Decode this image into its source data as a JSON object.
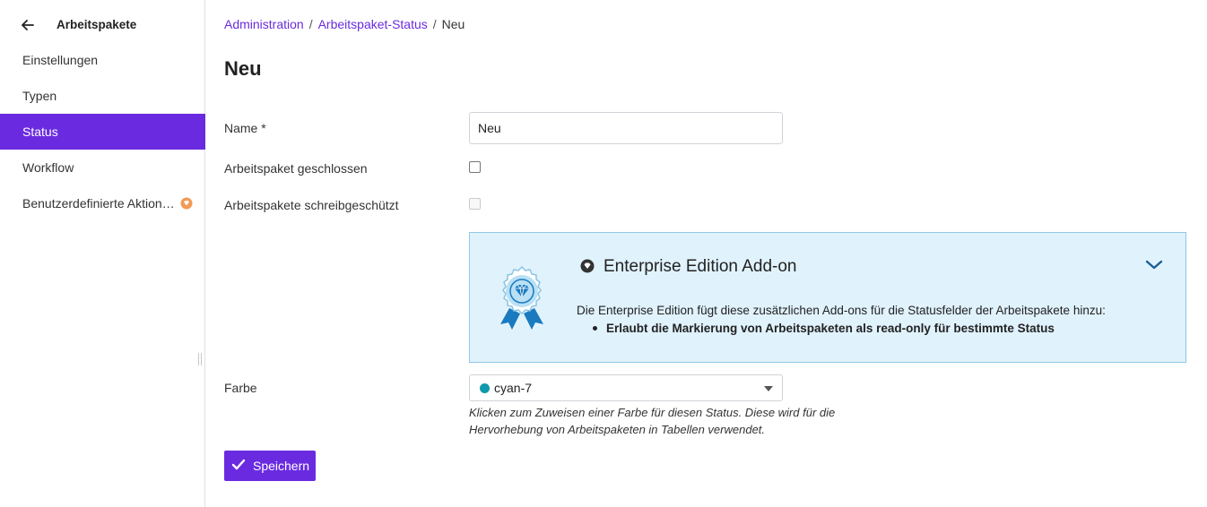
{
  "sidebar": {
    "title": "Arbeitspakete",
    "back_icon": "arrow-left-icon",
    "items": [
      {
        "label": "Einstellungen",
        "active": false
      },
      {
        "label": "Typen",
        "active": false
      },
      {
        "label": "Status",
        "active": true
      },
      {
        "label": "Workflow",
        "active": false
      },
      {
        "label": "Benutzerdefinierte Aktion…",
        "active": false,
        "badge_icon": "enterprise-badge-icon"
      }
    ]
  },
  "breadcrumb": {
    "items": [
      "Administration",
      "Arbeitspaket-Status"
    ],
    "current": "Neu",
    "separator": "/"
  },
  "page": {
    "title": "Neu"
  },
  "form": {
    "name_label": "Name *",
    "name_value": "Neu",
    "closed_label": "Arbeitspaket geschlossen",
    "readonly_label": "Arbeitspakete schreibgeschützt",
    "color_label": "Farbe",
    "color_value": "cyan-7",
    "color_swatch": "#1098ad",
    "color_help": "Klicken zum Zuweisen einer Farbe für diesen Status. Diese wird für die Hervorhebung von Arbeitspaketen in Tabellen verwendet.",
    "save_label": "Speichern"
  },
  "enterprise": {
    "title": "Enterprise Edition Add-on",
    "description": "Die Enterprise Edition fügt diese zusätzlichen Add-ons für die Statusfelder der Arbeitspakete hinzu:",
    "features": [
      "Erlaubt die Markierung von Arbeitspaketen als read-only für bestimmte Status"
    ]
  },
  "colors": {
    "accent": "#6a2be0",
    "enterprise_bg": "#e0f2fc",
    "enterprise_border": "#91c8e6",
    "badge_blue": "#1a7ac0"
  }
}
